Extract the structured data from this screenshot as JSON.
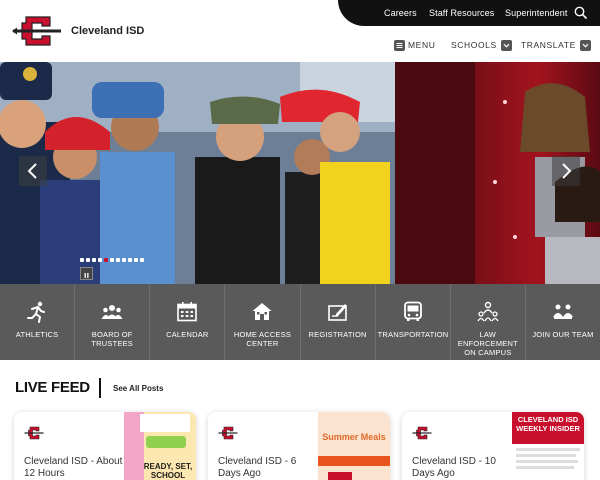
{
  "header": {
    "district_name": "Cleveland ISD",
    "top_links": [
      "Careers",
      "Staff Resources",
      "Superintendent"
    ],
    "nav": {
      "menu": "MENU",
      "schools": "SCHOOLS",
      "translate": "TRANSLATE"
    }
  },
  "hero": {
    "slide_count": 11,
    "active_slide": 5
  },
  "quick_links": [
    {
      "label": "ATHLETICS",
      "icon": "runner-icon"
    },
    {
      "label": "BOARD OF TRUSTEES",
      "icon": "people-group-icon"
    },
    {
      "label": "CALENDAR",
      "icon": "calendar-icon"
    },
    {
      "label": "HOME ACCESS CENTER",
      "icon": "home-icon"
    },
    {
      "label": "REGISTRATION",
      "icon": "registration-icon"
    },
    {
      "label": "TRANSPORTATION",
      "icon": "bus-icon"
    },
    {
      "label": "LAW ENFORCEMENT ON CAMPUS",
      "icon": "officer-icon"
    },
    {
      "label": "JOIN OUR TEAM",
      "icon": "team-icon"
    }
  ],
  "live_feed": {
    "title": "LIVE FEED",
    "see_all": "See All Posts",
    "posts": [
      {
        "text": "Cleveland ISD - About 12 Hours",
        "image_caption": "READY, SET, SCHOOL"
      },
      {
        "text": "Cleveland ISD - 6 Days Ago",
        "image_caption": "Summer Meals"
      },
      {
        "text": "Cleveland ISD - 10 Days Ago",
        "image_caption": "CLEVELAND ISD WEEKLY INSIDER"
      }
    ]
  },
  "colors": {
    "brand_red": "#c8102e",
    "topbar": "#111111",
    "quicklinks_bg": "#5a5a5a"
  }
}
